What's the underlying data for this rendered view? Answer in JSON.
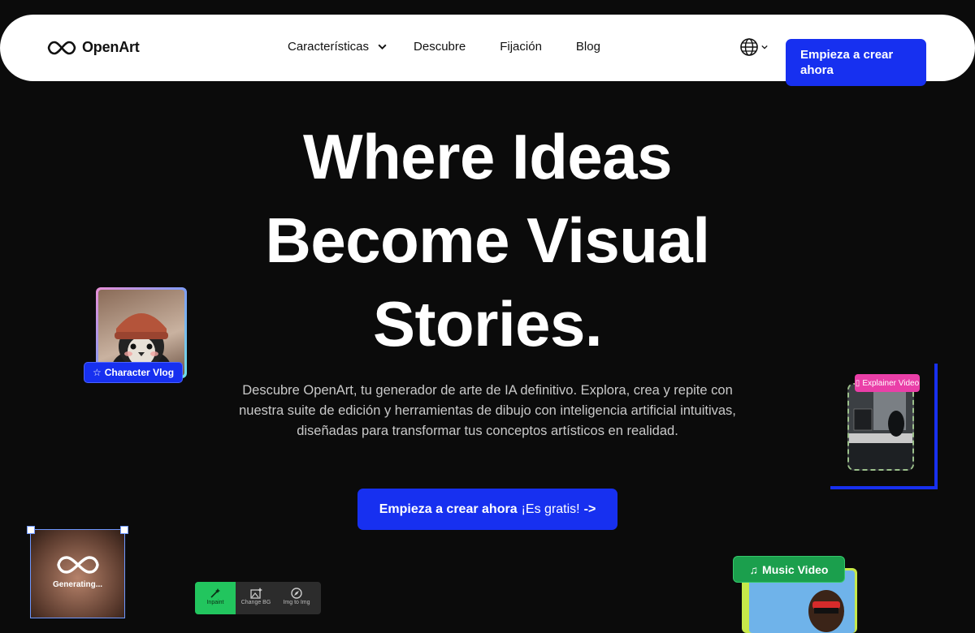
{
  "brand": {
    "name": "OpenArt"
  },
  "nav": {
    "items": [
      {
        "label": "Características"
      },
      {
        "label": "Descubre"
      },
      {
        "label": "Fijación"
      },
      {
        "label": "Blog"
      }
    ],
    "cta": "Empieza a crear ahora"
  },
  "hero": {
    "title_lines": [
      "Where Ideas",
      "Become Visual",
      "Stories."
    ],
    "subtitle": "Descubre OpenArt, tu generador de arte de IA definitivo. Explora, crea y repite con nuestra suite de edición y herramientas de dibujo con inteligencia artificial intuitivas, diseñadas para transformar tus conceptos artísticos en realidad.",
    "cta": {
      "bold": "Empieza a crear ahora",
      "light": "¡Es gratis!",
      "arrow": "->"
    }
  },
  "cards": {
    "character": {
      "label": "Character Vlog"
    },
    "explainer": {
      "label": "Explainer Video"
    },
    "generating": {
      "label": "Generating..."
    },
    "music": {
      "label": "Music Video"
    },
    "toolbar": [
      "Inpaint",
      "Change BG",
      "Img to Img"
    ]
  },
  "colors": {
    "accent": "#1730f0",
    "background": "#0b0b0b",
    "music_badge": "#1b9f4d",
    "explainer_badge": "#ea3fa8",
    "active_tool": "#22c55e"
  }
}
